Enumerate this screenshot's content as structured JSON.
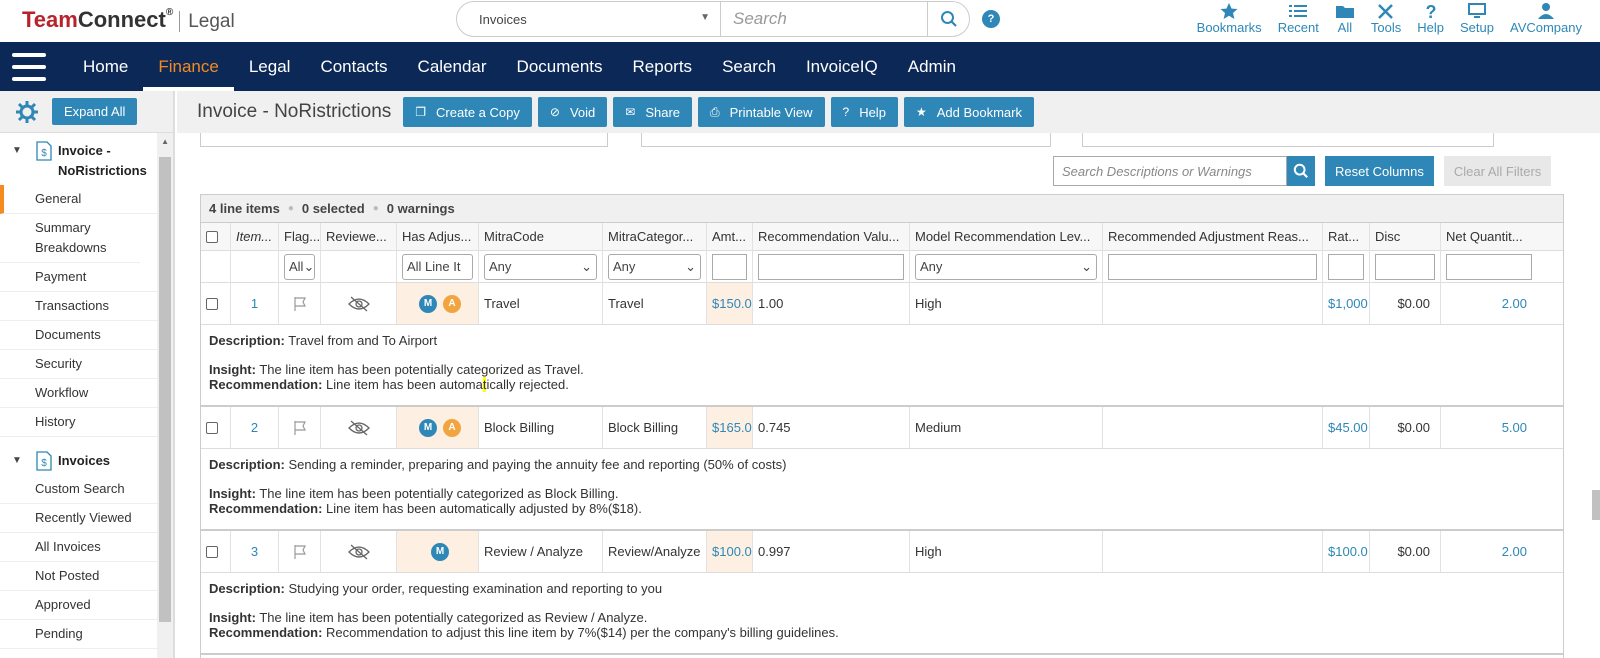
{
  "app": {
    "brand_team": "Team",
    "brand_connect": "Connect",
    "brand_sup": "®",
    "brand_legal": "Legal"
  },
  "search": {
    "type": "Invoices",
    "placeholder": "Search"
  },
  "top_icons": [
    {
      "label": "Bookmarks",
      "icon": "star-icon"
    },
    {
      "label": "Recent",
      "icon": "list-icon"
    },
    {
      "label": "All",
      "icon": "folder-icon"
    },
    {
      "label": "Tools",
      "icon": "tools-icon"
    },
    {
      "label": "Help",
      "icon": "question-icon"
    },
    {
      "label": "Setup",
      "icon": "monitor-icon"
    },
    {
      "label": "AVCompany",
      "icon": "user-icon"
    }
  ],
  "nav": [
    "Home",
    "Finance",
    "Legal",
    "Contacts",
    "Calendar",
    "Documents",
    "Reports",
    "Search",
    "InvoiceIQ",
    "Admin"
  ],
  "nav_active": "Finance",
  "sidebar": {
    "expand_label": "Expand All",
    "group1": {
      "title": "Invoice - NoRistrictions",
      "items": [
        "General",
        "Summary Breakdowns",
        "Payment",
        "Transactions",
        "Documents",
        "Security",
        "Workflow",
        "History"
      ],
      "active": "General"
    },
    "group2": {
      "title": "Invoices",
      "items": [
        "Custom Search",
        "Recently Viewed",
        "All Invoices",
        "Not Posted",
        "Approved",
        "Pending"
      ]
    }
  },
  "toolbar": {
    "title": "Invoice - NoRistrictions",
    "buttons": [
      "Create a Copy",
      "Void",
      "Share",
      "Printable View",
      "Help",
      "Add Bookmark"
    ]
  },
  "filters": {
    "search_placeholder": "Search Descriptions or Warnings",
    "reset": "Reset Columns",
    "clear": "Clear All Filters"
  },
  "grid": {
    "stats": {
      "line_items": "4 line items",
      "selected": "0 selected",
      "warnings": "0 warnings"
    },
    "headers": [
      "Item...",
      "Flag...",
      "Reviewe...",
      "Has Adjus...",
      "MitraCode",
      "MitraCategor...",
      "Amt...",
      "Recommendation Valu...",
      "Model Recommendation Lev...",
      "Recommended Adjustment Reas...",
      "Rat...",
      "Disc",
      "Net Quantit..."
    ],
    "filter_values": {
      "flag": "All",
      "adjust": "All Line It",
      "mitra_code": "Any",
      "mitra_cat": "Any",
      "model_level": "Any"
    },
    "rows": [
      {
        "item": "1",
        "badges": [
          "M",
          "A"
        ],
        "code": "Travel",
        "category": "Travel",
        "amt": "$150.0",
        "rec_value": "1.00",
        "level": "High",
        "rate": "$1,000",
        "disc": "$0.00",
        "qty": "2.00",
        "desc_label": "Description:",
        "desc": "Travel from and To Airport",
        "insight_label": "Insight:",
        "insight": "The line item has been potentially categorized as Travel.",
        "rec_label": "Recommendation:",
        "rec_pre": "Line item has been automa",
        "rec_hl": "t",
        "rec_post": "ically rejected."
      },
      {
        "item": "2",
        "badges": [
          "M",
          "A"
        ],
        "code": "Block Billing",
        "category": "Block Billing",
        "amt": "$165.0",
        "rec_value": "0.745",
        "level": "Medium",
        "rate": "$45.00",
        "disc": "$0.00",
        "qty": "5.00",
        "desc_label": "Description:",
        "desc": "Sending a reminder, preparing and paying the annuity fee and reporting (50% of costs)",
        "insight_label": "Insight:",
        "insight": "The line item has been potentially categorized as Block Billing.",
        "rec_label": "Recommendation:",
        "rec_pre": "Line item has been automatically adjusted by 8%($18).",
        "rec_hl": "",
        "rec_post": ""
      },
      {
        "item": "3",
        "badges": [
          "M"
        ],
        "code": "Review / Analyze",
        "category": "Review/Analyze",
        "amt": "$100.0",
        "rec_value": "0.997",
        "level": "High",
        "rate": "$100.0",
        "disc": "$0.00",
        "qty": "2.00",
        "desc_label": "Description:",
        "desc": "Studying your order, requesting examination and reporting to you",
        "insight_label": "Insight:",
        "insight": "The line item has been potentially categorized as Review / Analyze.",
        "rec_label": "Recommendation:",
        "rec_pre": "Recommendation to adjust this line item by 7%($14) per the company's billing guidelines.",
        "rec_hl": "",
        "rec_post": ""
      }
    ]
  },
  "colors": {
    "nav_bg": "#0b2856",
    "accent": "#2e87b7",
    "active_nav": "#f58a1f",
    "brand_red": "#b8222b",
    "adjust_bg": "#fdf0e3"
  }
}
